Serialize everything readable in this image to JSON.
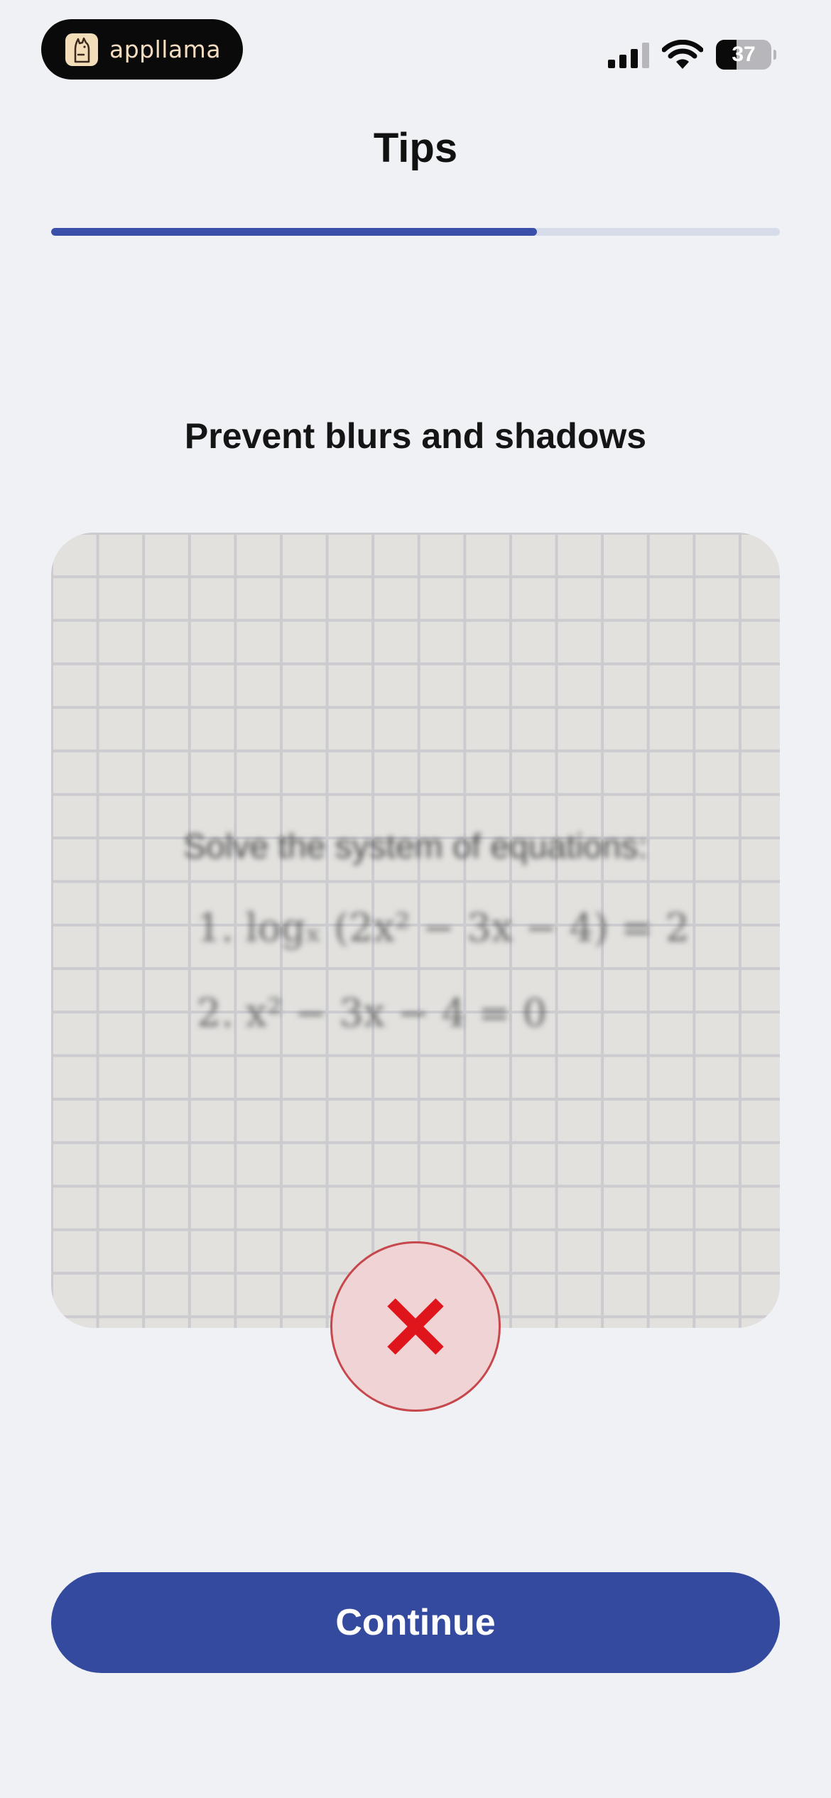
{
  "status_bar": {
    "brand_name": "appllama",
    "battery_level": "37",
    "battery_fraction": 0.37
  },
  "header": {
    "title": "Tips",
    "progress_fraction": 0.667
  },
  "tip": {
    "heading": "Prevent blurs and shadows",
    "image": {
      "problem_title": "Solve the system of equations:",
      "equation_1": "1. logₓ (2x² − 3x − 4) = 2",
      "equation_2": "2. x² − 3x − 4 = 0"
    },
    "status_icon": "x-mark-icon"
  },
  "actions": {
    "continue_label": "Continue"
  },
  "colors": {
    "accent": "#344a9e",
    "progress": "#3a4fa8",
    "error": "#e0141b",
    "error_bg": "#efd3d5",
    "background": "#eff1f5"
  }
}
